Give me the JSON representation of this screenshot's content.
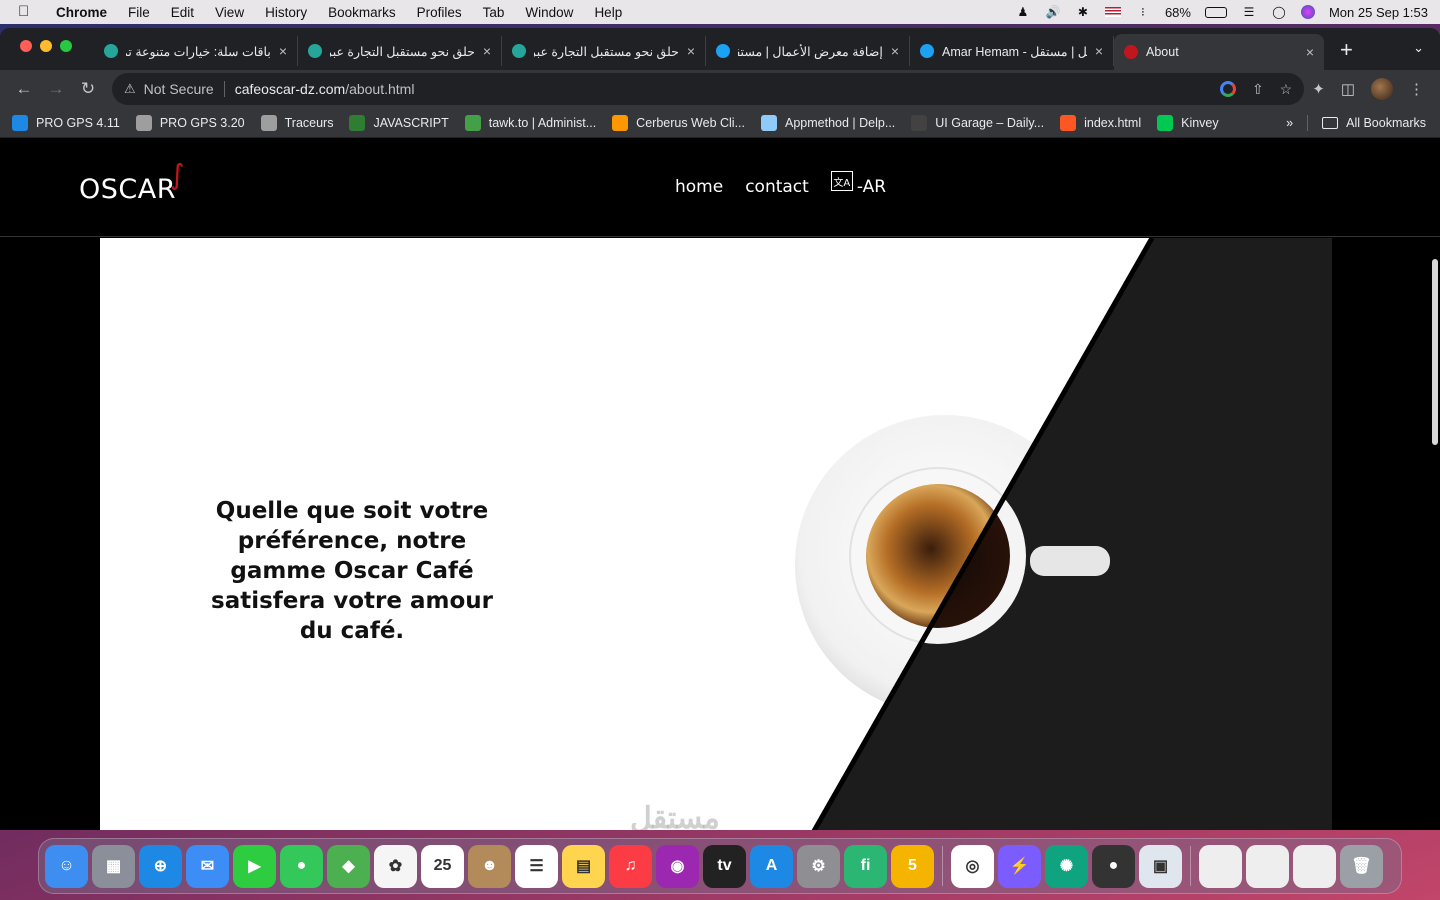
{
  "menubar": {
    "app": "Chrome",
    "items": [
      "File",
      "Edit",
      "View",
      "History",
      "Bookmarks",
      "Profiles",
      "Tab",
      "Window",
      "Help"
    ],
    "battery": "68%",
    "datetime": "Mon 25 Sep  1:53"
  },
  "tabs": [
    {
      "title": "باقات سلة: خيارات متنوعة تم",
      "fav_color": "#26a69a",
      "rtl": true
    },
    {
      "title": "حلق نحو مستقبل التجارة عبر",
      "fav_color": "#26a69a",
      "rtl": true
    },
    {
      "title": "حلق نحو مستقبل التجارة عبر",
      "fav_color": "#26a69a",
      "rtl": true
    },
    {
      "title": "إضافة معرض الأعمال | مستقل",
      "fav_color": "#1da1f2",
      "rtl": true
    },
    {
      "title": "Amar Hemam - مستقل | مستقل",
      "fav_color": "#1da1f2",
      "rtl": false
    },
    {
      "title": "About",
      "fav_color": "#c0171e",
      "rtl": false,
      "active": true
    }
  ],
  "omnibox": {
    "security": "Not Secure",
    "host": "cafeoscar-dz.com",
    "path": "/about.html"
  },
  "bookmarks": [
    {
      "label": "PRO GPS 4.11",
      "color": "#1e88e5"
    },
    {
      "label": "PRO GPS 3.20",
      "color": "#9e9e9e"
    },
    {
      "label": "Traceurs",
      "color": "#9e9e9e"
    },
    {
      "label": "JAVASCRIPT",
      "color": "#2e7d32"
    },
    {
      "label": "tawk.to | Administ...",
      "color": "#43a047"
    },
    {
      "label": "Cerberus Web Cli...",
      "color": "#ff9800"
    },
    {
      "label": "Appmethod | Delp...",
      "color": "#90caf9"
    },
    {
      "label": "UI Garage – Daily...",
      "color": "#424242"
    },
    {
      "label": "index.html",
      "color": "#ff5722"
    },
    {
      "label": "Kinvey",
      "color": "#00c853"
    }
  ],
  "bookmarks_all": "All Bookmarks",
  "site": {
    "logo": "OSCAR",
    "nav": {
      "home": "home",
      "contact": "contact",
      "lang": "-AR"
    },
    "hero_text": "Quelle que soit votre préférence, notre gamme Oscar Café satisfera votre amour du café."
  },
  "watermark": "مستقل",
  "dock": [
    {
      "name": "finder",
      "color": "#3d8ef0",
      "glyph": "☺"
    },
    {
      "name": "launchpad",
      "color": "#8a8f99",
      "glyph": "▦"
    },
    {
      "name": "safari",
      "color": "#1e88e5",
      "glyph": "⊕"
    },
    {
      "name": "mail",
      "color": "#3c8df5",
      "glyph": "✉"
    },
    {
      "name": "facetime",
      "color": "#2ecc40",
      "glyph": "▶"
    },
    {
      "name": "messages",
      "color": "#34c759",
      "glyph": "●"
    },
    {
      "name": "maps",
      "color": "#4caf50",
      "glyph": "◆"
    },
    {
      "name": "photos",
      "color": "#f5f5f5",
      "glyph": "✿"
    },
    {
      "name": "calendar",
      "color": "#ffffff",
      "glyph": "25"
    },
    {
      "name": "contacts",
      "color": "#b38a5a",
      "glyph": "☻"
    },
    {
      "name": "reminders",
      "color": "#ffffff",
      "glyph": "☰"
    },
    {
      "name": "notes",
      "color": "#ffd54f",
      "glyph": "▤"
    },
    {
      "name": "music",
      "color": "#fc3c44",
      "glyph": "♫"
    },
    {
      "name": "podcasts",
      "color": "#9c27b0",
      "glyph": "◉"
    },
    {
      "name": "tv",
      "color": "#222222",
      "glyph": "tv"
    },
    {
      "name": "app-store",
      "color": "#1e88e5",
      "glyph": "A"
    },
    {
      "name": "system-settings",
      "color": "#8e8e93",
      "glyph": "⚙"
    },
    {
      "name": "mostaql",
      "color": "#2bb673",
      "glyph": "fi"
    },
    {
      "name": "html5-editor",
      "color": "#f4b400",
      "glyph": "5"
    },
    {
      "name": "chrome",
      "color": "#ffffff",
      "glyph": "◎"
    },
    {
      "name": "messenger",
      "color": "#7b5cff",
      "glyph": "⚡"
    },
    {
      "name": "chatgpt",
      "color": "#10a37f",
      "glyph": "✺"
    },
    {
      "name": "screen-recorder",
      "color": "#333333",
      "glyph": "●"
    },
    {
      "name": "preview",
      "color": "#dfe6ee",
      "glyph": "▣"
    },
    {
      "name": "doc-thumb-1",
      "color": "#eeeeee",
      "glyph": ""
    },
    {
      "name": "doc-thumb-2",
      "color": "#eeeeee",
      "glyph": ""
    },
    {
      "name": "doc-thumb-3",
      "color": "#eeeeee",
      "glyph": ""
    },
    {
      "name": "trash",
      "color": "#9aa0a6",
      "glyph": "🗑"
    }
  ]
}
